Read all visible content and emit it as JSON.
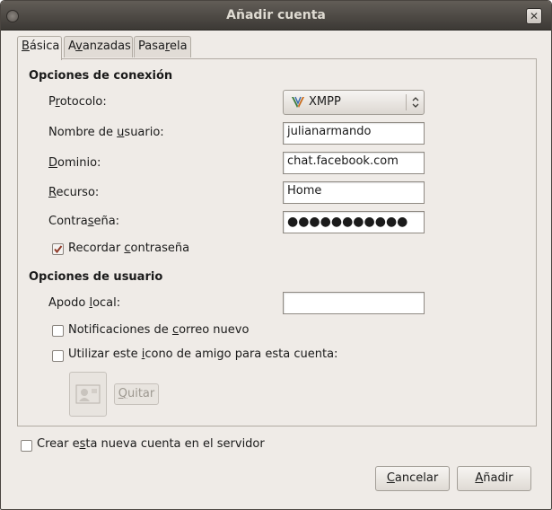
{
  "window": {
    "title": "Añadir cuenta",
    "close_glyph": "✕"
  },
  "tabs": [
    {
      "pre": "",
      "mnemonic": "B",
      "post": "ásica",
      "active": true
    },
    {
      "pre": "A",
      "mnemonic": "v",
      "post": "anzadas",
      "active": false
    },
    {
      "pre": "Pasa",
      "mnemonic": "r",
      "post": "ela",
      "active": false
    }
  ],
  "connection": {
    "heading": "Opciones de conexión",
    "protocol": {
      "pre": "P",
      "mnemonic": "r",
      "post": "otocolo:",
      "value": "XMPP",
      "icon": "xmpp-icon"
    },
    "username": {
      "pre": "Nombre de ",
      "mnemonic": "u",
      "post": "suario:",
      "value": "julianarmando"
    },
    "domain": {
      "pre": "",
      "mnemonic": "D",
      "post": "ominio:",
      "value": "chat.facebook.com"
    },
    "resource": {
      "pre": "",
      "mnemonic": "R",
      "post": "ecurso:",
      "value": "Home"
    },
    "password": {
      "pre": "Contra",
      "mnemonic": "s",
      "post": "eña:",
      "value": "●●●●●●●●●●●"
    },
    "remember": {
      "pre": "Recordar ",
      "mnemonic": "c",
      "post": "ontraseña",
      "checked": true
    }
  },
  "user": {
    "heading": "Opciones de usuario",
    "alias": {
      "pre": "Apodo ",
      "mnemonic": "l",
      "post": "ocal:",
      "value": ""
    },
    "mail_notify": {
      "pre": "Notificaciones de ",
      "mnemonic": "c",
      "post": "orreo nuevo",
      "checked": false
    },
    "buddy_icon": {
      "pre": "Utilizar este ",
      "mnemonic": "i",
      "post": "cono de amigo para esta cuenta:",
      "checked": false
    },
    "remove": {
      "pre": "",
      "mnemonic": "Q",
      "post": "uitar"
    }
  },
  "register": {
    "pre": "Crear e",
    "mnemonic": "s",
    "post": "ta nueva cuenta en el servidor",
    "checked": false
  },
  "buttons": {
    "cancel": {
      "pre": "",
      "mnemonic": "C",
      "post": "ancelar"
    },
    "add": {
      "pre": "",
      "mnemonic": "A",
      "post": "ñadir"
    }
  },
  "colors": {
    "accent_check": "#8f3a29",
    "titlebar": "#3c3935",
    "dialog_bg": "#efebe7"
  }
}
